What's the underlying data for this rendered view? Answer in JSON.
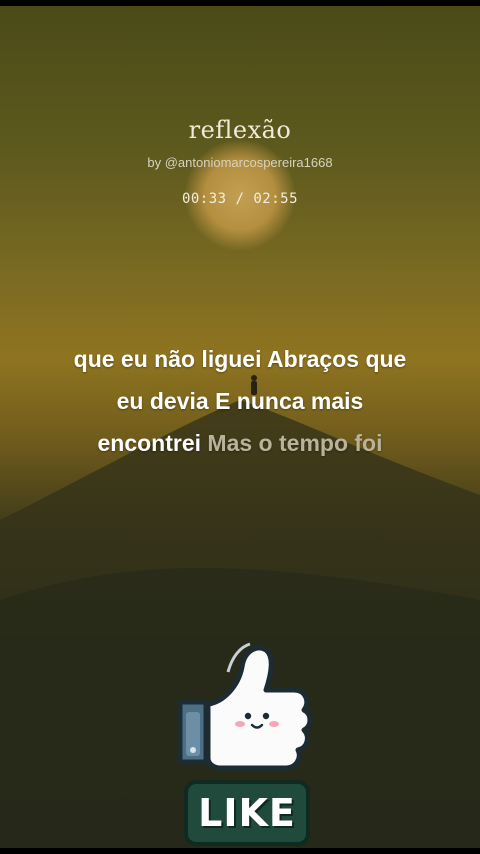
{
  "header": {
    "title": "reflexão",
    "byline": "by @antoniomarcospereira1668",
    "timer": "00:33 / 02:55"
  },
  "lyrics": {
    "line1": "que eu não liguei Abraços que",
    "line2": "eu devia E nunca mais",
    "line3_sung": "encontrei",
    "line3_upcoming": "Mas o tempo foi"
  },
  "like_sticker": {
    "label": "LIKE",
    "icon": "thumbs-up-icon"
  },
  "colors": {
    "accent_text": "#ffffff",
    "upcoming_text": "#b9b39b",
    "like_green": "#1f4a3c"
  }
}
